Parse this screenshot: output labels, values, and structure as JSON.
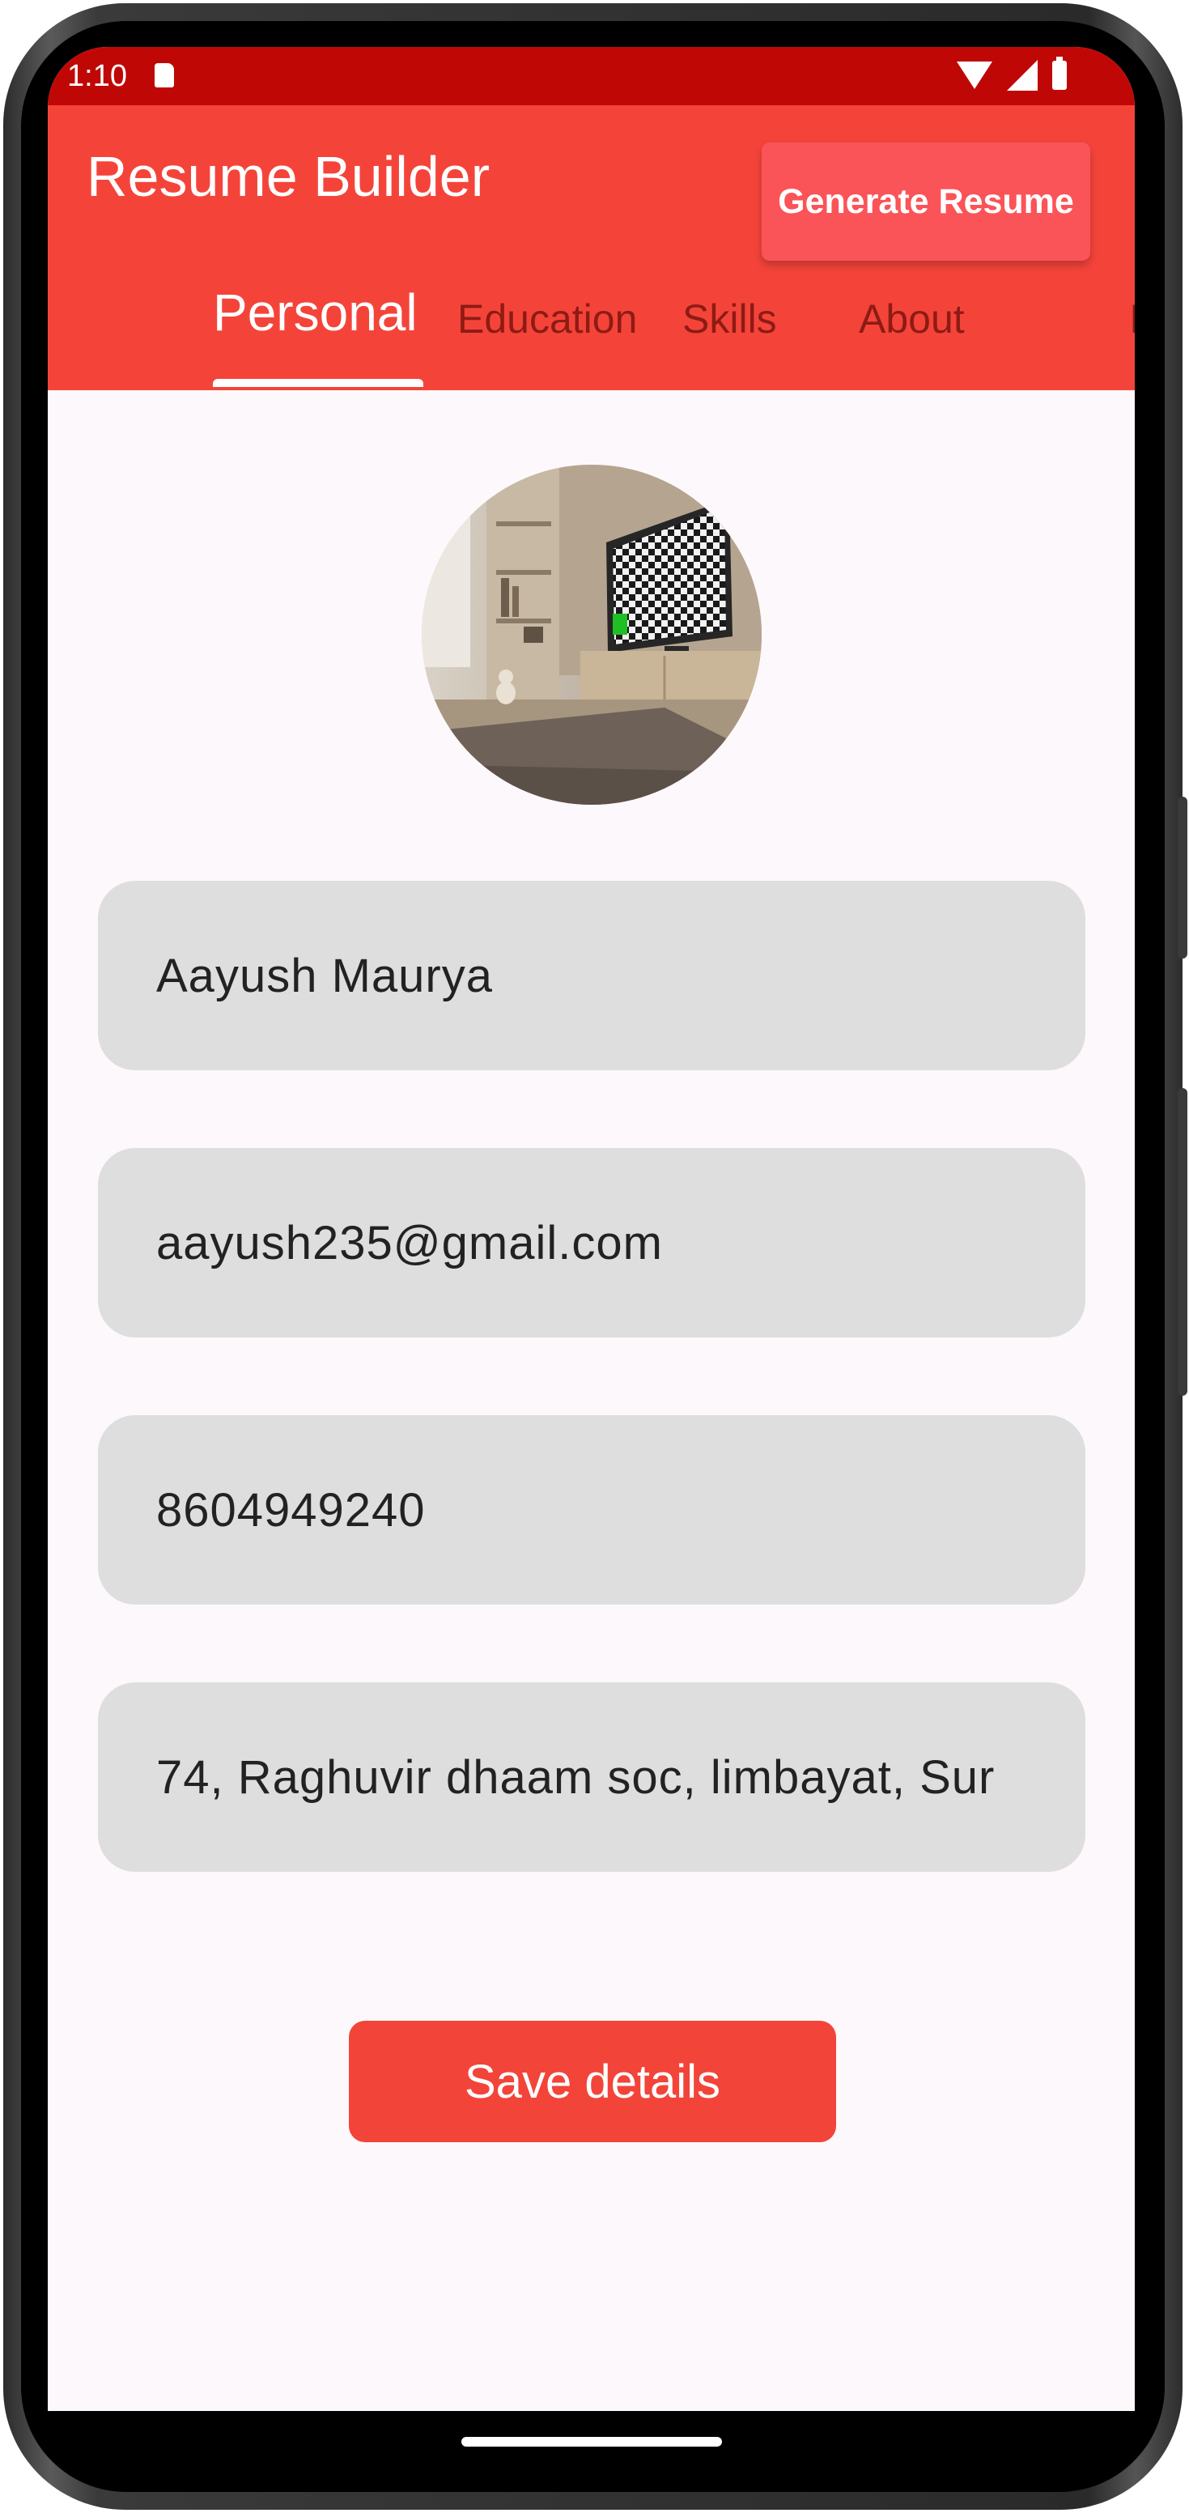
{
  "status_bar": {
    "time": "1:10",
    "icons": [
      "sd-card-icon",
      "wifi-icon",
      "cell-signal-icon",
      "battery-icon"
    ]
  },
  "app_bar": {
    "title": "Resume Builder",
    "generate_label": "Generate Resume"
  },
  "tabs": [
    {
      "label": "Personal",
      "active": true
    },
    {
      "label": "Education",
      "active": false
    },
    {
      "label": "Skills",
      "active": false
    },
    {
      "label": "About",
      "active": false
    },
    {
      "label": "I",
      "active": false
    }
  ],
  "form": {
    "name": "Aayush Maurya",
    "email": "aayush235@gmail.com",
    "phone": "8604949240",
    "address": "74, Raghuvir dhaam soc, limbayat, Sur"
  },
  "save_label": "Save details",
  "colors": {
    "status_bar": "#bf0806",
    "app_bar": "#f4443a",
    "generate_button": "#fa5458",
    "field_bg": "#dedede",
    "save_button": "#f3443a",
    "tab_inactive": "#8d1b14"
  }
}
